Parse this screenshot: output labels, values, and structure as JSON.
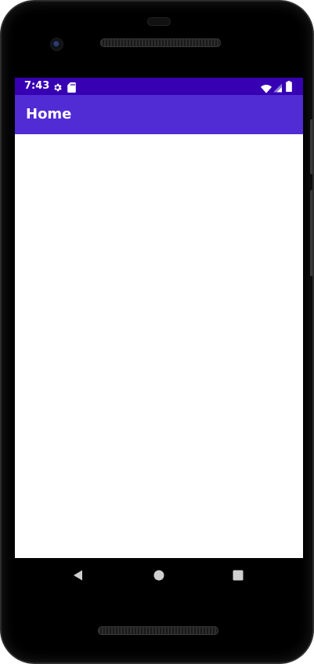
{
  "status_bar": {
    "time": "7:43",
    "icons": [
      "gear-icon",
      "sd-card-icon",
      "wifi-icon",
      "cell-signal-icon",
      "battery-icon"
    ]
  },
  "app_bar": {
    "title": "Home"
  },
  "navigation": {
    "buttons": [
      "back-button",
      "home-button",
      "recents-button"
    ]
  },
  "colors": {
    "status_bar": "#3700B3",
    "app_bar": "#512BD4",
    "content_background": "#FFFFFF",
    "device_frame": "#000000"
  }
}
